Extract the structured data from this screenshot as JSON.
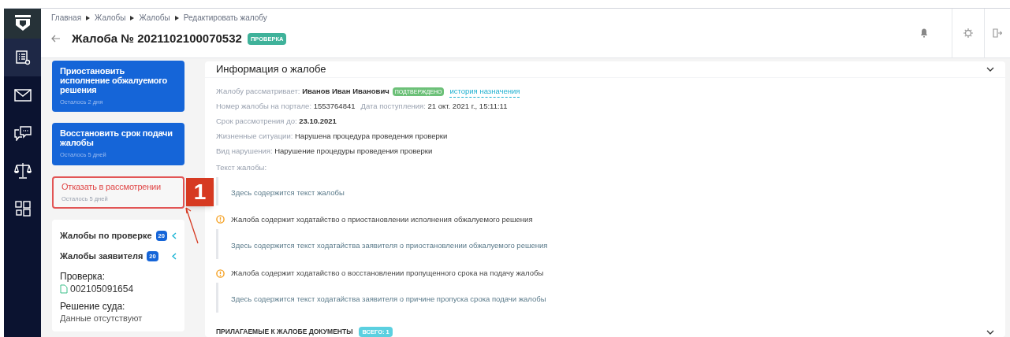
{
  "sidebar": {
    "items": [
      {
        "kind": "list",
        "selected": true
      },
      {
        "kind": "mail",
        "selected": false
      },
      {
        "kind": "chat",
        "selected": false
      },
      {
        "kind": "scales",
        "selected": false
      },
      {
        "kind": "grid",
        "selected": false
      }
    ]
  },
  "header": {
    "breadcrumbs": [
      "Главная",
      "Жалобы",
      "Жалобы",
      "Редактировать жалобу"
    ],
    "title": "Жалоба № 2021102100070532",
    "status_badge": "ПРОВЕРКА"
  },
  "actions": [
    {
      "kind": "primary",
      "title": "Приостановить исполнение обжалуемого решения",
      "subtitle": "Осталось 2 дня"
    },
    {
      "kind": "primary",
      "title": "Восстановить срок подачи жалобы",
      "subtitle": "Осталось 5 дней"
    },
    {
      "kind": "danger",
      "title": "Отказать в рассмотрении",
      "subtitle": "Осталось 5 дней"
    }
  ],
  "callout": {
    "number": "1"
  },
  "related": {
    "items": [
      {
        "label": "Жалобы по проверке",
        "count": "20"
      },
      {
        "label": "Жалобы заявителя",
        "count": "20"
      }
    ],
    "inspection_label": "Проверка:",
    "inspection_number": "002105091654",
    "court_label": "Решение суда:",
    "court_value": "Данные отсутствуют"
  },
  "info": {
    "title": "Информация о жалобе",
    "rows": [
      {
        "parts": [
          {
            "label": "Жалобу рассматривает:",
            "value": "Иванов Иван Иванович",
            "bold": true
          }
        ],
        "badge": "ПОДТВЕРЖДЕНО",
        "link": "история назначения"
      },
      {
        "parts": [
          {
            "label": "Номер жалобы на портале:",
            "value": "1553764841",
            "bold": false
          },
          {
            "label": "Дата поступления:",
            "value": "21 окт. 2021 г., 15:11:11",
            "bold": false
          }
        ]
      },
      {
        "parts": [
          {
            "label": "Срок рассмотрения до:",
            "value": "23.10.2021",
            "bold": true
          }
        ]
      },
      {
        "parts": [
          {
            "label": "Жизненные ситуации:",
            "value": "Нарушена процедура проведения проверки",
            "bold": false
          }
        ]
      },
      {
        "parts": [
          {
            "label": "Вид нарушения:",
            "value": "Нарушение процедуры проведения проверки",
            "bold": false
          }
        ]
      }
    ],
    "text_label": "Текст жалобы:",
    "text": "Здесь содержится текст жалобы",
    "petitions": [
      {
        "notice": "Жалоба содержит ходатайство о приостановлении исполнения обжалуемого решения",
        "text": "Здесь содержится текст ходатайства заявителя о приостановлении обжалуемого решения"
      },
      {
        "notice": "Жалоба содержит ходатайство о восстановлении пропущенного срока на подачу жалобы",
        "text": "Здесь содержится текст ходатайства заявителя о причине пропуска срока подачи жалобы"
      }
    ]
  },
  "documents": {
    "title": "ПРИЛАГАЕМЫЕ К ЖАЛОБЕ ДОКУМЕНТЫ",
    "count_badge": "ВСЕГО: 1"
  }
}
